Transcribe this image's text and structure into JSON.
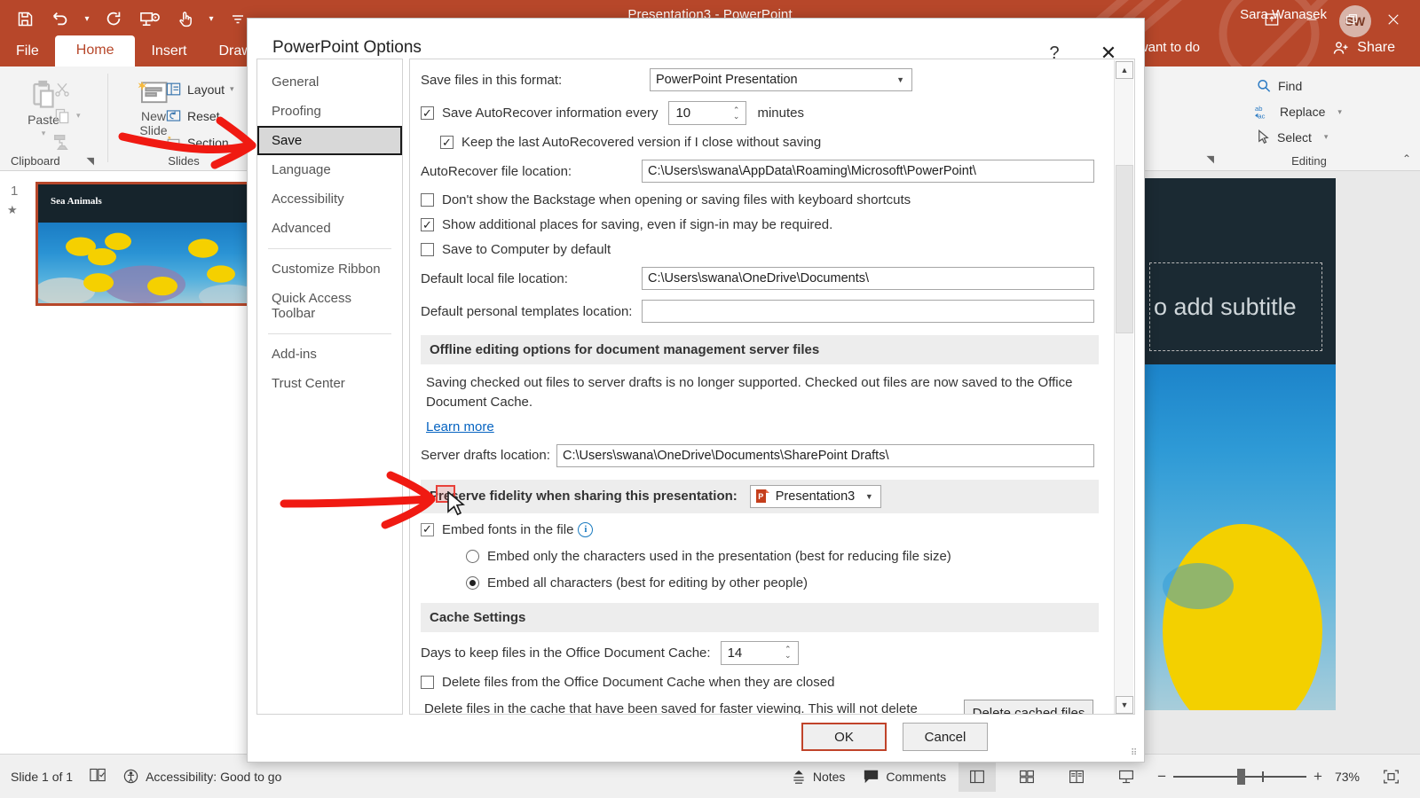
{
  "app": {
    "document_title": "Presentation3  -  PowerPoint",
    "user_name": "Sara Wanasek",
    "avatar_initials": "SW",
    "tell_me_placeholder": "what you want to do",
    "share_label": "Share"
  },
  "quick_access": [
    {
      "name": "save-icon",
      "glyph": "❐"
    },
    {
      "name": "undo-icon",
      "glyph": "↶"
    },
    {
      "name": "redo-icon",
      "glyph": "↻"
    },
    {
      "name": "start-presentation-icon",
      "glyph": "▶"
    },
    {
      "name": "touch-mode-icon",
      "glyph": "☝"
    },
    {
      "name": "customize-qat-icon",
      "glyph": "≡"
    }
  ],
  "ribbon": {
    "tabs": [
      {
        "label": "File",
        "active": false
      },
      {
        "label": "Home",
        "active": true
      },
      {
        "label": "Insert",
        "active": false
      },
      {
        "label": "Draw",
        "active": false
      }
    ],
    "groups": {
      "clipboard": {
        "label": "Clipboard",
        "paste_label": "Paste",
        "cut_icon": "scissors-icon",
        "copy_icon": "copy-icon",
        "format_painter_icon": "format-painter-icon"
      },
      "slides": {
        "label": "Slides",
        "new_slide_label": "New\nSlide",
        "layout_label": "Layout",
        "reset_label": "Reset",
        "section_label": "Section"
      },
      "editing": {
        "label": "Editing",
        "find_label": "Find",
        "replace_label": "Replace",
        "select_label": "Select"
      }
    }
  },
  "thumbnail_pane": {
    "slide_number": "1",
    "slide_title": "Sea Animals"
  },
  "slide_canvas": {
    "subtitle_placeholder": "o add subtitle"
  },
  "status_bar": {
    "slide_count": "Slide 1 of 1",
    "accessibility": "Accessibility: Good to go",
    "notes_label": "Notes",
    "comments_label": "Comments",
    "zoom_level": "73%"
  },
  "dialog": {
    "title": "PowerPoint Options",
    "help_glyph": "?",
    "close_glyph": "✕",
    "nav_items": [
      {
        "label": "General",
        "selected": false,
        "sep_after": false
      },
      {
        "label": "Proofing",
        "selected": false,
        "sep_after": false
      },
      {
        "label": "Save",
        "selected": true,
        "sep_after": false
      },
      {
        "label": "Language",
        "selected": false,
        "sep_after": false
      },
      {
        "label": "Accessibility",
        "selected": false,
        "sep_after": false
      },
      {
        "label": "Advanced",
        "selected": false,
        "sep_after": true
      },
      {
        "label": "Customize Ribbon",
        "selected": false,
        "sep_after": false
      },
      {
        "label": "Quick Access Toolbar",
        "selected": false,
        "sep_after": true
      },
      {
        "label": "Add-ins",
        "selected": false,
        "sep_after": false
      },
      {
        "label": "Trust Center",
        "selected": false,
        "sep_after": false
      }
    ],
    "save_format_label": "Save files in this format:",
    "save_format_value": "PowerPoint Presentation",
    "autorecover_label": "Save AutoRecover information every",
    "autorecover_minutes": "10",
    "minutes_label": "minutes",
    "keep_last_label": "Keep the last AutoRecovered version if I close without saving",
    "autorecover_loc_label": "AutoRecover file location:",
    "autorecover_loc_value": "C:\\Users\\swana\\AppData\\Roaming\\Microsoft\\PowerPoint\\",
    "dont_show_backstage_label": "Don't show the Backstage when opening or saving files with keyboard shortcuts",
    "show_additional_label": "Show additional places for saving, even if sign-in may be required.",
    "save_to_computer_label": "Save to Computer by default",
    "default_local_label": "Default local file location:",
    "default_local_value": "C:\\Users\\swana\\OneDrive\\Documents\\",
    "default_templates_label": "Default personal templates location:",
    "default_templates_value": "",
    "offline_header": "Offline editing options for document management server files",
    "offline_paragraph": "Saving checked out files to server drafts is no longer supported. Checked out files are now saved to the Office Document Cache.",
    "learn_more_label": "Learn more",
    "server_drafts_label": "Server drafts location:",
    "server_drafts_value": "C:\\Users\\swana\\OneDrive\\Documents\\SharePoint Drafts\\",
    "preserve_fidelity_label": "Preserve fidelity when sharing this presentation:",
    "preserve_fidelity_value": "Presentation3",
    "embed_fonts_label": "Embed fonts in the file",
    "embed_only_label": "Embed only the characters used in the presentation (best for reducing file size)",
    "embed_all_label": "Embed all characters (best for editing by other people)",
    "cache_header": "Cache Settings",
    "cache_days_label": "Days to keep files in the Office Document Cache:",
    "cache_days_value": "14",
    "delete_on_close_label": "Delete files from the Office Document Cache when they are closed",
    "cache_paragraph": "Delete files in the cache that have been saved for faster viewing. This will not delete items pending upload to the server, nor items with upload errors.",
    "delete_cached_btn": "Delete cached files",
    "ok_label": "OK",
    "cancel_label": "Cancel",
    "checkbox_states": {
      "save_autorecover": true,
      "keep_last": true,
      "dont_show_backstage": false,
      "show_additional": true,
      "save_to_computer": false,
      "embed_fonts": true,
      "delete_on_close": false
    },
    "radio_selected": "embed_all"
  },
  "colors": {
    "brand": "#b7472a",
    "annotation_red": "#f01a12",
    "highlight_border": "#e8413a",
    "link_blue": "#0563c1",
    "ok_focus": "#c0432a"
  }
}
